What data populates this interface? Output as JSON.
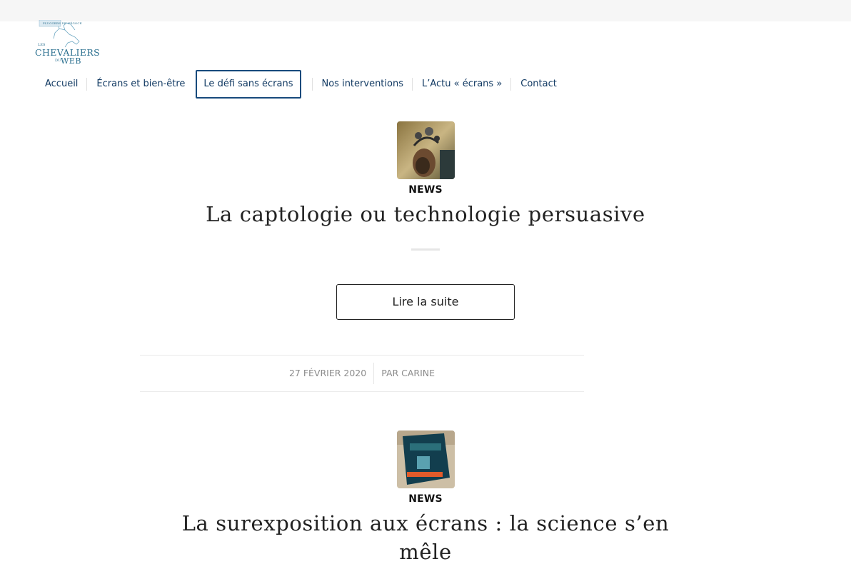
{
  "logo": {
    "top_text": "PLUGGERS DE NÉGOCE",
    "les": "LES",
    "name": "CHEVALIERS",
    "du": "DU",
    "web": "WEB"
  },
  "nav": {
    "items": [
      {
        "label": "Accueil"
      },
      {
        "label": "Écrans et bien-être"
      },
      {
        "label": "Le défi sans écrans"
      },
      {
        "label": "Nos interventions"
      },
      {
        "label": "L’Actu « écrans »"
      },
      {
        "label": "Contact"
      }
    ],
    "active_index": 2
  },
  "posts": [
    {
      "category": "NEWS",
      "title": "La captologie ou technologie persuasive",
      "read_more": "Lire la suite",
      "date": "27 FÉVRIER 2020",
      "author": "PAR CARINE"
    },
    {
      "category": "NEWS",
      "title_line1": "La surexposition aux écrans : la science s’en",
      "title_line2": "mêle"
    }
  ],
  "colors": {
    "nav_text": "#123a63",
    "nav_active_border": "#174a7c",
    "meta_text": "#8b8b8b"
  }
}
